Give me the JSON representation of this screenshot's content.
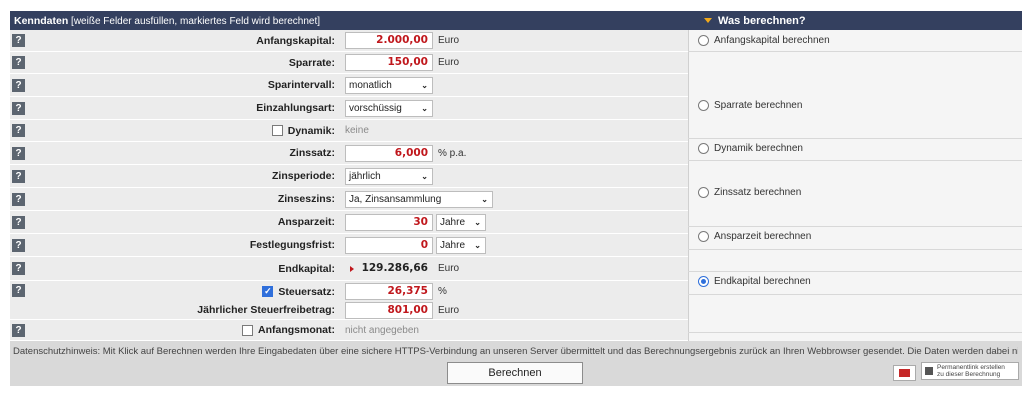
{
  "header": {
    "title": "Kenndaten",
    "subtitle": "[weiße Felder ausfüllen, markiertes Feld wird berechnet]",
    "right_title": "Was berechnen?"
  },
  "help_label": "?",
  "rows": {
    "anfangskapital": {
      "label": "Anfangskapital:",
      "value": "2.000,00",
      "unit": "Euro"
    },
    "sparrate": {
      "label": "Sparrate:",
      "value": "150,00",
      "unit": "Euro"
    },
    "sparintervall": {
      "label": "Sparintervall:",
      "value": "monatlich"
    },
    "einzahlungsart": {
      "label": "Einzahlungsart:",
      "value": "vorschüssig"
    },
    "dynamik": {
      "label": "Dynamik:",
      "value": "keine",
      "checked": false
    },
    "zinssatz": {
      "label": "Zinssatz:",
      "value": "6,000",
      "unit": "% p.a."
    },
    "zinsperiode": {
      "label": "Zinsperiode:",
      "value": "jährlich"
    },
    "zinseszins": {
      "label": "Zinseszins:",
      "value": "Ja, Zinsansammlung"
    },
    "ansparzeit": {
      "label": "Ansparzeit:",
      "value": "30",
      "unit_select": "Jahre"
    },
    "festlegungsfrist": {
      "label": "Festlegungsfrist:",
      "value": "0",
      "unit_select": "Jahre"
    },
    "endkapital": {
      "label": "Endkapital:",
      "value": "129.286,66",
      "unit": "Euro"
    },
    "steuersatz": {
      "label": "Steuersatz:",
      "value": "26,375",
      "unit": "%",
      "checked": true
    },
    "freibetrag": {
      "label": "Jährlicher Steuerfreibetrag:",
      "value": "801,00",
      "unit": "Euro"
    },
    "anfangsmonat": {
      "label": "Anfangsmonat:",
      "value": "nicht angegeben",
      "checked": false
    }
  },
  "radios": {
    "anfangskapital": "Anfangskapital berechnen",
    "sparrate": "Sparrate berechnen",
    "dynamik": "Dynamik berechnen",
    "zinssatz": "Zinssatz berechnen",
    "ansparzeit": "Ansparzeit berechnen",
    "endkapital": "Endkapital berechnen",
    "selected": "endkapital"
  },
  "footer": {
    "privacy": "Datenschutzhinweis: Mit Klick auf Berechnen werden Ihre Eingabedaten über eine sichere HTTPS-Verbindung an unseren Server übermittelt und das Berechnungsergebnis zurück an Ihren Webbrowser gesendet. Die Daten werden dabei nicht gespeichert.",
    "calc_button": "Berechnen",
    "perma_line1": "Permanentlink erstellen",
    "perma_line2": "zu dieser Berechnung"
  },
  "colors": {
    "header_bg": "#34405f",
    "value_red": "#c0171c",
    "accent_blue": "#2f6fdb",
    "header_triangle": "#f1a91b"
  }
}
